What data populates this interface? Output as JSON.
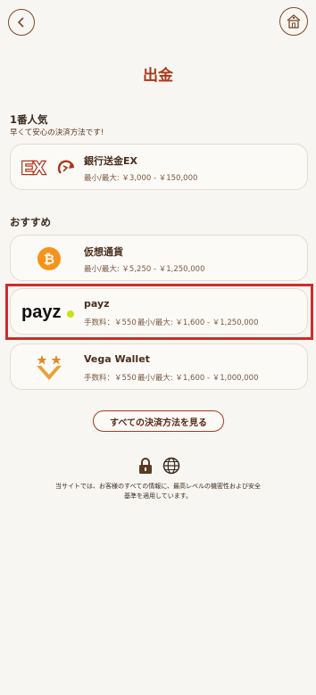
{
  "header": {
    "title": "出金"
  },
  "popular": {
    "title": "1番人気",
    "subtitle": "早くて安心の決済方法です!"
  },
  "recommended": {
    "title": "おすすめ"
  },
  "methods": [
    {
      "name": "銀行送金EX",
      "limits": "最小/最大: ￥3,000 - ￥150,000",
      "logo_text": "EX"
    },
    {
      "name": "仮想通貨",
      "limits": "最小/最大: ￥5,250 - ￥1,250,000",
      "logo_text": "₿"
    },
    {
      "name": "payz",
      "fee": "手数料：￥550",
      "limits": "最小/最大: ￥1,600 - ￥1,250,000",
      "logo_text": "payz"
    },
    {
      "name": "Vega Wallet",
      "fee": "手数料：￥550",
      "limits": "最小/最大: ￥1,600 - ￥1,000,000"
    }
  ],
  "all_methods_label": "すべての決済方法を見る",
  "footer": {
    "line1": "当サイトでは、お客様のすべての情報に、最高レベルの機密性および安全",
    "line2": "基準を適用しています。"
  },
  "colors": {
    "accent": "#a8391d",
    "highlight": "#d22a2a",
    "bitcoin": "#f7931a",
    "payz_dot": "#c9e21a"
  }
}
